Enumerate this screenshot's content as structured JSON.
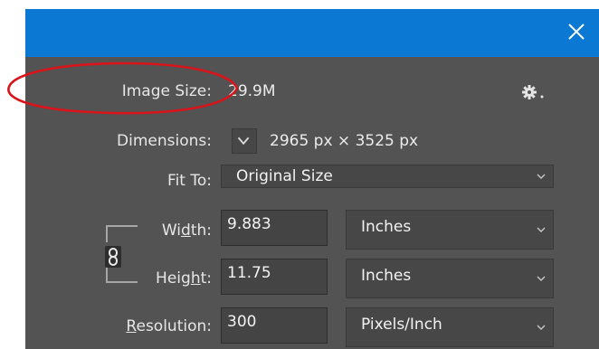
{
  "dialog": {
    "image_size": {
      "label": "Image Size:",
      "value": "29.9M"
    },
    "dimensions": {
      "label": "Dimensions:",
      "value": "2965 px  ×  3525 px"
    },
    "fit_to": {
      "label": "Fit To:",
      "selected": "Original Size"
    },
    "width": {
      "label_pre": "Wi",
      "label_u": "d",
      "label_post": "th:",
      "value": "9.883",
      "unit": "Inches"
    },
    "height": {
      "label_pre": "Heig",
      "label_u": "h",
      "label_post": "t:",
      "value": "11.75",
      "unit": "Inches"
    },
    "resolution": {
      "label_u": "R",
      "label_post": "esolution:",
      "value": "300",
      "unit": "Pixels/Inch"
    }
  },
  "icons": {
    "close": "close-icon",
    "settings": "gear-icon",
    "dropdown": "chevron-down-icon",
    "constrain": "chain-link-icon"
  },
  "colors": {
    "titlebar": "#0b78d4",
    "panel": "#535353",
    "annotation": "#d9141b"
  }
}
